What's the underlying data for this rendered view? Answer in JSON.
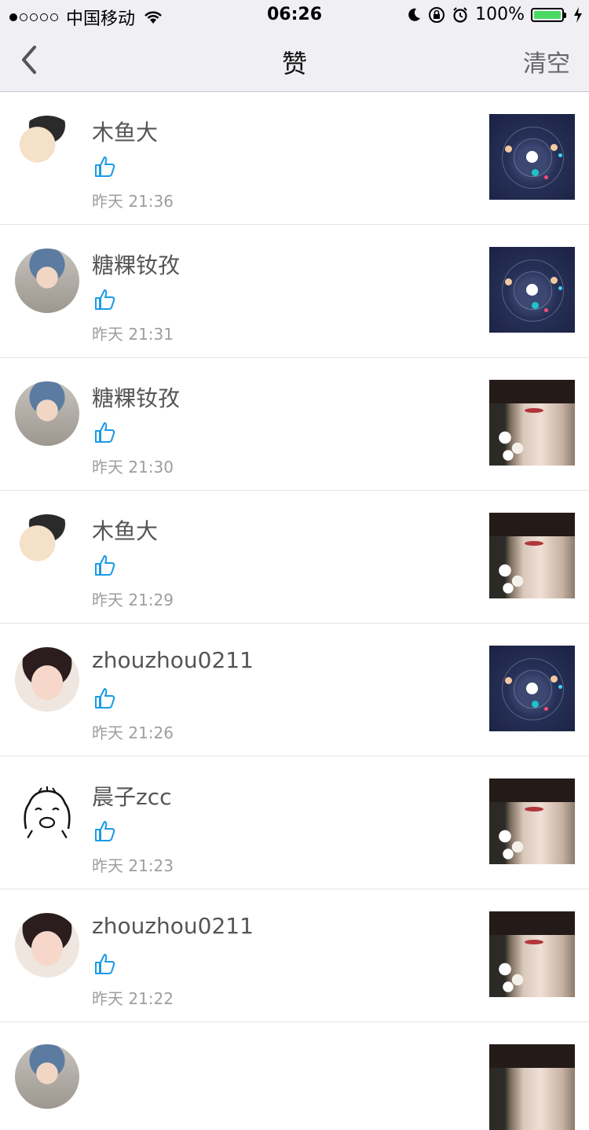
{
  "status_bar": {
    "carrier": "中国移动",
    "time": "06:26",
    "battery": "100%"
  },
  "nav": {
    "title": "赞",
    "right_label": "清空"
  },
  "likes": [
    {
      "name": "木鱼大",
      "time": "昨天 21:36",
      "avatar": "a1",
      "thumb": "space"
    },
    {
      "name": "糖粿钕孜",
      "time": "昨天 21:31",
      "avatar": "a2",
      "thumb": "space"
    },
    {
      "name": "糖粿钕孜",
      "time": "昨天 21:30",
      "avatar": "a2",
      "thumb": "portrait"
    },
    {
      "name": "木鱼大",
      "time": "昨天 21:29",
      "avatar": "a1",
      "thumb": "portrait"
    },
    {
      "name": "zhouzhou0211",
      "time": "昨天 21:26",
      "avatar": "a3",
      "thumb": "space"
    },
    {
      "name": "晨子zcc",
      "time": "昨天 21:23",
      "avatar": "a4",
      "thumb": "portrait"
    },
    {
      "name": "zhouzhou0211",
      "time": "昨天 21:22",
      "avatar": "a3",
      "thumb": "portrait"
    }
  ],
  "colors": {
    "accent": "#1a9be6",
    "nav_bg": "#efeff4",
    "time_text": "#9e9e9e"
  }
}
